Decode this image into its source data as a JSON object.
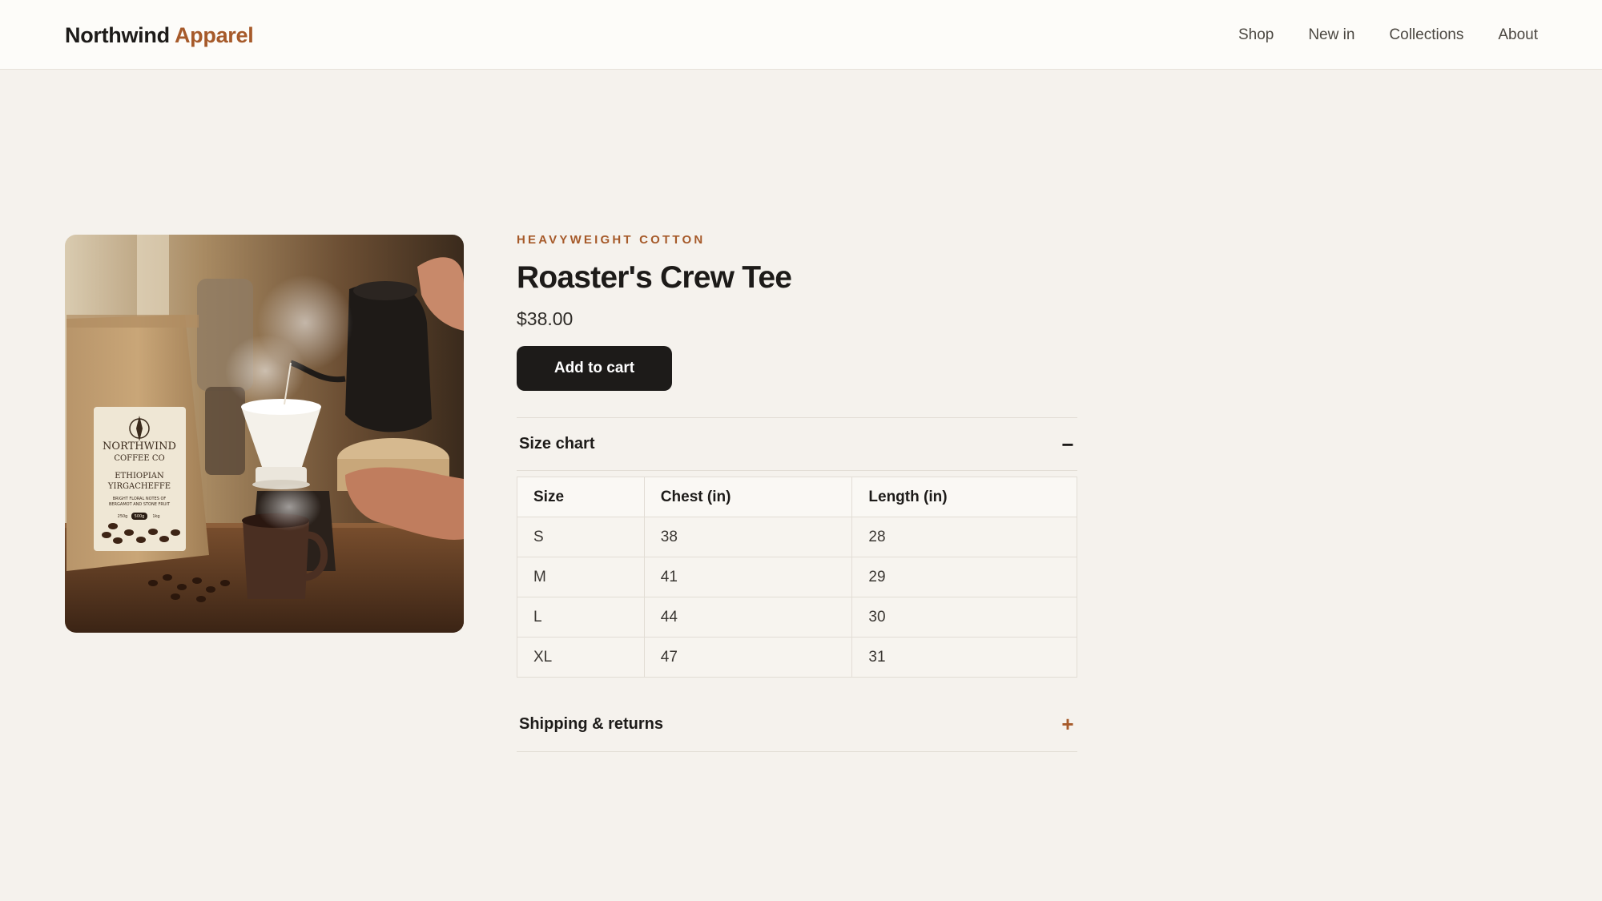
{
  "brand": {
    "name": "Northwind",
    "accent": "Apparel"
  },
  "nav": {
    "items": [
      {
        "label": "Shop"
      },
      {
        "label": "New in"
      },
      {
        "label": "Collections"
      },
      {
        "label": "About"
      }
    ]
  },
  "product": {
    "eyebrow": "HEAVYWEIGHT COTTON",
    "title": "Roaster's Crew Tee",
    "price": "$38.00",
    "add_to_cart": "Add to cart",
    "image": {
      "bag_brand_line1": "NORTHWIND",
      "bag_brand_line2": "COFFEE CO",
      "bag_origin_line1": "ETHIOPIAN",
      "bag_origin_line2": "YIRGACHEFFE",
      "bag_notes_line1": "BRIGHT FLORAL NOTES OF",
      "bag_notes_line2": "BERGAMOT AND STONE FRUIT",
      "bag_sizes": [
        "250g",
        "500g",
        "1kg"
      ]
    }
  },
  "size_chart": {
    "title": "Size chart",
    "toggle": "−",
    "headers": [
      "Size",
      "Chest (in)",
      "Length (in)"
    ],
    "rows": [
      [
        "S",
        "38",
        "28"
      ],
      [
        "M",
        "41",
        "29"
      ],
      [
        "L",
        "44",
        "30"
      ],
      [
        "XL",
        "47",
        "31"
      ]
    ]
  },
  "shipping": {
    "title": "Shipping & returns",
    "toggle": "+"
  },
  "colors": {
    "accent": "#a65a2a",
    "ink": "#1d1b19",
    "background": "#f5f2ed",
    "header_bg": "#fdfcf9"
  }
}
